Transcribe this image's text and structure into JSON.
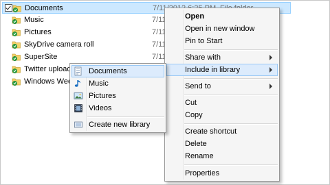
{
  "files": [
    {
      "name": "Documents",
      "date": "7/11/2012 6:25 PM",
      "type": "File folder",
      "checked": true
    },
    {
      "name": "Music",
      "date": "7/11",
      "type": ""
    },
    {
      "name": "Pictures",
      "date": "7/11",
      "type": ""
    },
    {
      "name": "SkyDrive camera roll",
      "date": "7/11",
      "type": ""
    },
    {
      "name": "SuperSite",
      "date": "7/11",
      "type": ""
    },
    {
      "name": "Twitter upload",
      "date": "",
      "type": ""
    },
    {
      "name": "Windows Week",
      "date": "",
      "type": ""
    }
  ],
  "context_menu": {
    "open": "Open",
    "open_new_window": "Open in new window",
    "pin_to_start": "Pin to Start",
    "share_with": "Share with",
    "include_in_library": "Include in library",
    "send_to": "Send to",
    "cut": "Cut",
    "copy": "Copy",
    "create_shortcut": "Create shortcut",
    "delete": "Delete",
    "rename": "Rename",
    "properties": "Properties"
  },
  "library_submenu": {
    "documents": "Documents",
    "music": "Music",
    "pictures": "Pictures",
    "videos": "Videos",
    "create_new_library": "Create new library"
  },
  "colors": {
    "selection_bg": "#cce8ff",
    "menu_bg": "#f5f5f5",
    "menu_hover": "#dcebfc",
    "folder_yellow": "#f4d26b",
    "sync_green": "#2ea043"
  },
  "icons": {
    "folder": "folder-icon",
    "sync_badge": "sync-check-icon",
    "documents": "documents-library-icon",
    "music": "music-library-icon",
    "pictures": "pictures-library-icon",
    "videos": "videos-library-icon",
    "new_library": "new-library-icon"
  }
}
